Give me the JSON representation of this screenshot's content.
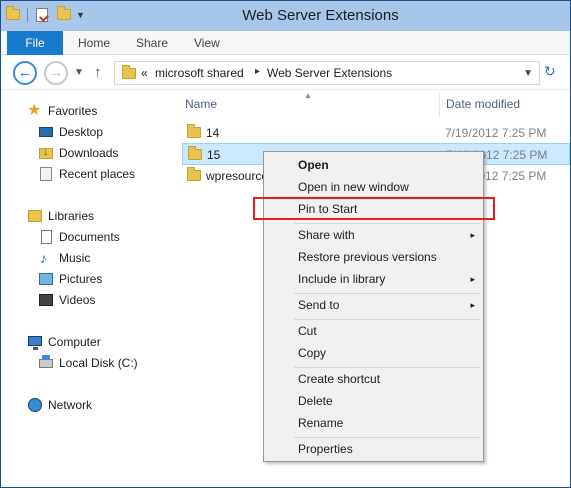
{
  "window": {
    "title": "Web Server Extensions"
  },
  "ribbon": {
    "tabs": [
      "File",
      "Home",
      "Share",
      "View"
    ]
  },
  "address": {
    "overflow": "«",
    "crumbs": [
      "microsoft shared",
      "Web Server Extensions"
    ]
  },
  "nav_pane": {
    "favorites": {
      "label": "Favorites",
      "items": [
        "Desktop",
        "Downloads",
        "Recent places"
      ]
    },
    "libraries": {
      "label": "Libraries",
      "items": [
        "Documents",
        "Music",
        "Pictures",
        "Videos"
      ]
    },
    "computer": {
      "label": "Computer",
      "items": [
        "Local Disk (C:)"
      ]
    },
    "network": {
      "label": "Network"
    }
  },
  "file_list": {
    "columns": {
      "name": "Name",
      "date": "Date modified"
    },
    "rows": [
      {
        "name": "14",
        "date": "7/19/2012 7:25 PM",
        "selected": false
      },
      {
        "name": "15",
        "date": "7/19/2012 7:25 PM",
        "selected": true
      },
      {
        "name": "wpresources",
        "date": "7/19/2012 7:25 PM",
        "selected": false
      }
    ]
  },
  "context_menu": {
    "items": [
      "Open",
      "Open in new window",
      "Pin to Start",
      "Share with",
      "Restore previous versions",
      "Include in library",
      "Send to",
      "Cut",
      "Copy",
      "Create shortcut",
      "Delete",
      "Rename",
      "Properties"
    ],
    "submenu_arrow": "▸"
  },
  "colors": {
    "titlebar": "#a7c6ea",
    "file_tab": "#1979ca",
    "selection": "#cce8ff",
    "highlight_box": "#e02020"
  }
}
